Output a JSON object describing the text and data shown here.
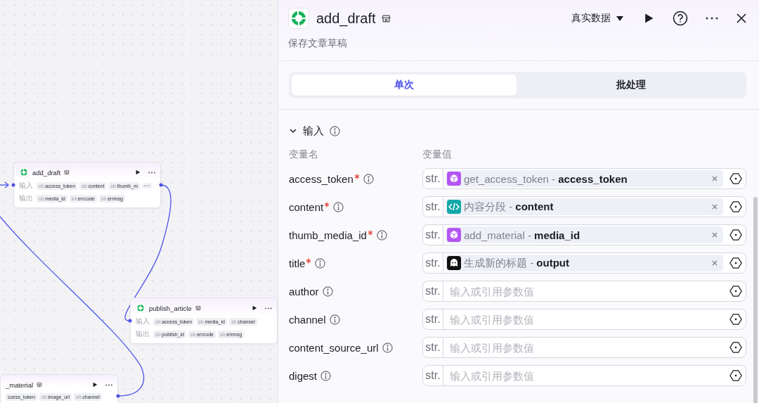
{
  "canvas": {
    "nodes": [
      {
        "title": "add_draft",
        "logo": true,
        "input_label": "输入",
        "output_label": "输出",
        "inputs": [
          {
            "type": "str.",
            "name": "access_token"
          },
          {
            "type": "str.",
            "name": "content"
          },
          {
            "type": "str.",
            "name": "thumb_m"
          }
        ],
        "more_inputs": true,
        "outputs": [
          {
            "type": "str.",
            "name": "media_id"
          },
          {
            "type": "int.",
            "name": "errcode"
          },
          {
            "type": "str.",
            "name": "errmsg"
          }
        ]
      },
      {
        "title": "publish_article",
        "logo": true,
        "input_label": "输入",
        "output_label": "输出",
        "inputs": [
          {
            "type": "str.",
            "name": "access_token"
          },
          {
            "type": "str.",
            "name": "media_id"
          },
          {
            "type": "str.",
            "name": "channel"
          }
        ],
        "more_inputs": false,
        "outputs": [
          {
            "type": "str.",
            "name": "publish_id"
          },
          {
            "type": "str.",
            "name": "errcode"
          },
          {
            "type": "str.",
            "name": "errmsg"
          }
        ]
      },
      {
        "title": "_material",
        "logo": false,
        "inputs": [
          {
            "name": "ccess_token"
          },
          {
            "type": "str.",
            "name": "image_url"
          },
          {
            "type": "str.",
            "name": "channel"
          }
        ],
        "more_inputs": false
      }
    ]
  },
  "panel": {
    "title": "add_draft",
    "subtitle": "保存文章草稿",
    "data_mode": "真实数据",
    "tabs": [
      {
        "label": "单次",
        "selected": true
      },
      {
        "label": "批处理",
        "selected": false
      }
    ],
    "section": {
      "title": "输入",
      "expanded": true,
      "name_header": "变量名",
      "value_header": "变量值",
      "params": [
        {
          "name": "access_token",
          "required": true,
          "type": "str.",
          "value": "get_access_token - **access_token**",
          "kind": "plugin"
        },
        {
          "name": "content",
          "required": true,
          "type": "str.",
          "value": "内容分段 - **content**",
          "kind": "code"
        },
        {
          "name": "thumb_media_id",
          "required": true,
          "type": "str.",
          "value": "add_material - **media_id**",
          "kind": "plugin"
        },
        {
          "name": "title",
          "required": true,
          "type": "str.",
          "value": "生成新的标题 - **output**",
          "kind": "llm"
        },
        {
          "name": "author",
          "required": false,
          "type": "str.",
          "placeholder": "输入或引用参数值"
        },
        {
          "name": "channel",
          "required": false,
          "type": "str.",
          "placeholder": "输入或引用参数值"
        },
        {
          "name": "content_source_url",
          "required": false,
          "type": "str.",
          "placeholder": "输入或引用参数值"
        },
        {
          "name": "digest",
          "required": false,
          "type": "str.",
          "placeholder": "输入或引用参数值"
        }
      ]
    }
  }
}
